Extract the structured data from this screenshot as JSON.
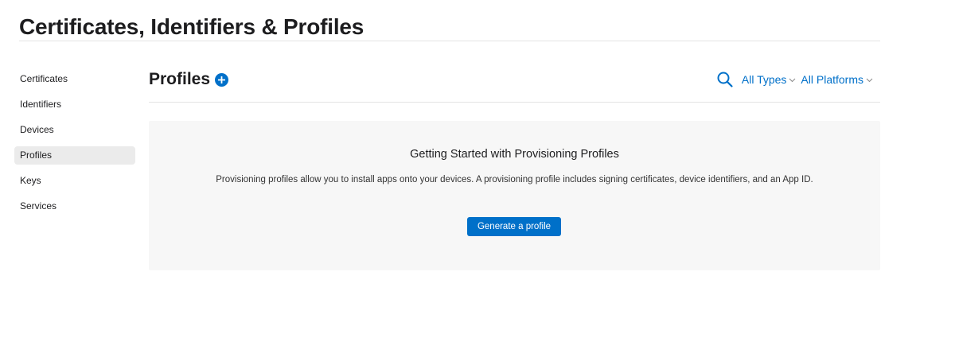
{
  "header": {
    "title": "Certificates, Identifiers & Profiles"
  },
  "sidebar": {
    "items": [
      {
        "label": "Certificates",
        "active": false
      },
      {
        "label": "Identifiers",
        "active": false
      },
      {
        "label": "Devices",
        "active": false
      },
      {
        "label": "Profiles",
        "active": true
      },
      {
        "label": "Keys",
        "active": false
      },
      {
        "label": "Services",
        "active": false
      }
    ]
  },
  "section": {
    "title": "Profiles",
    "add_icon": "plus-circle-icon",
    "search_icon": "search-icon",
    "filters": [
      {
        "label": "All Types"
      },
      {
        "label": "All Platforms"
      }
    ]
  },
  "empty_state": {
    "title": "Getting Started with Provisioning Profiles",
    "description": "Provisioning profiles allow you to install apps onto your devices. A provisioning profile includes signing certificates, device identifiers, and an App ID.",
    "button_label": "Generate a profile"
  },
  "colors": {
    "accent": "#0070c9",
    "active_nav_bg": "#ebebeb",
    "panel_bg": "#f7f7f7"
  }
}
